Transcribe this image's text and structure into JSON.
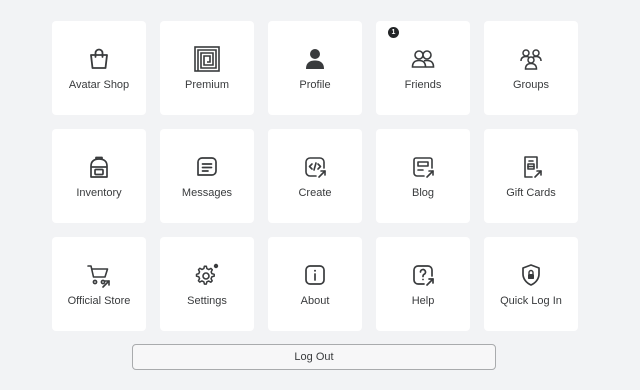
{
  "tiles": [
    {
      "label": "Avatar Shop",
      "icon": "shopping-bag-icon"
    },
    {
      "label": "Premium",
      "icon": "premium-icon"
    },
    {
      "label": "Profile",
      "icon": "profile-icon"
    },
    {
      "label": "Friends",
      "icon": "friends-icon",
      "badge": "1"
    },
    {
      "label": "Groups",
      "icon": "groups-icon"
    },
    {
      "label": "Inventory",
      "icon": "backpack-icon"
    },
    {
      "label": "Messages",
      "icon": "message-icon"
    },
    {
      "label": "Create",
      "icon": "create-icon"
    },
    {
      "label": "Blog",
      "icon": "blog-icon"
    },
    {
      "label": "Gift Cards",
      "icon": "gift-card-icon"
    },
    {
      "label": "Official Store",
      "icon": "cart-icon"
    },
    {
      "label": "Settings",
      "icon": "gear-icon"
    },
    {
      "label": "About",
      "icon": "info-icon"
    },
    {
      "label": "Help",
      "icon": "help-icon"
    },
    {
      "label": "Quick Log In",
      "icon": "shield-lock-icon"
    }
  ],
  "logout": {
    "label": "Log Out"
  },
  "colors": {
    "background": "#f2f3f5",
    "tile": "#ffffff",
    "text": "#393b3d",
    "icon": "#393b3d",
    "badge": "#232527"
  }
}
